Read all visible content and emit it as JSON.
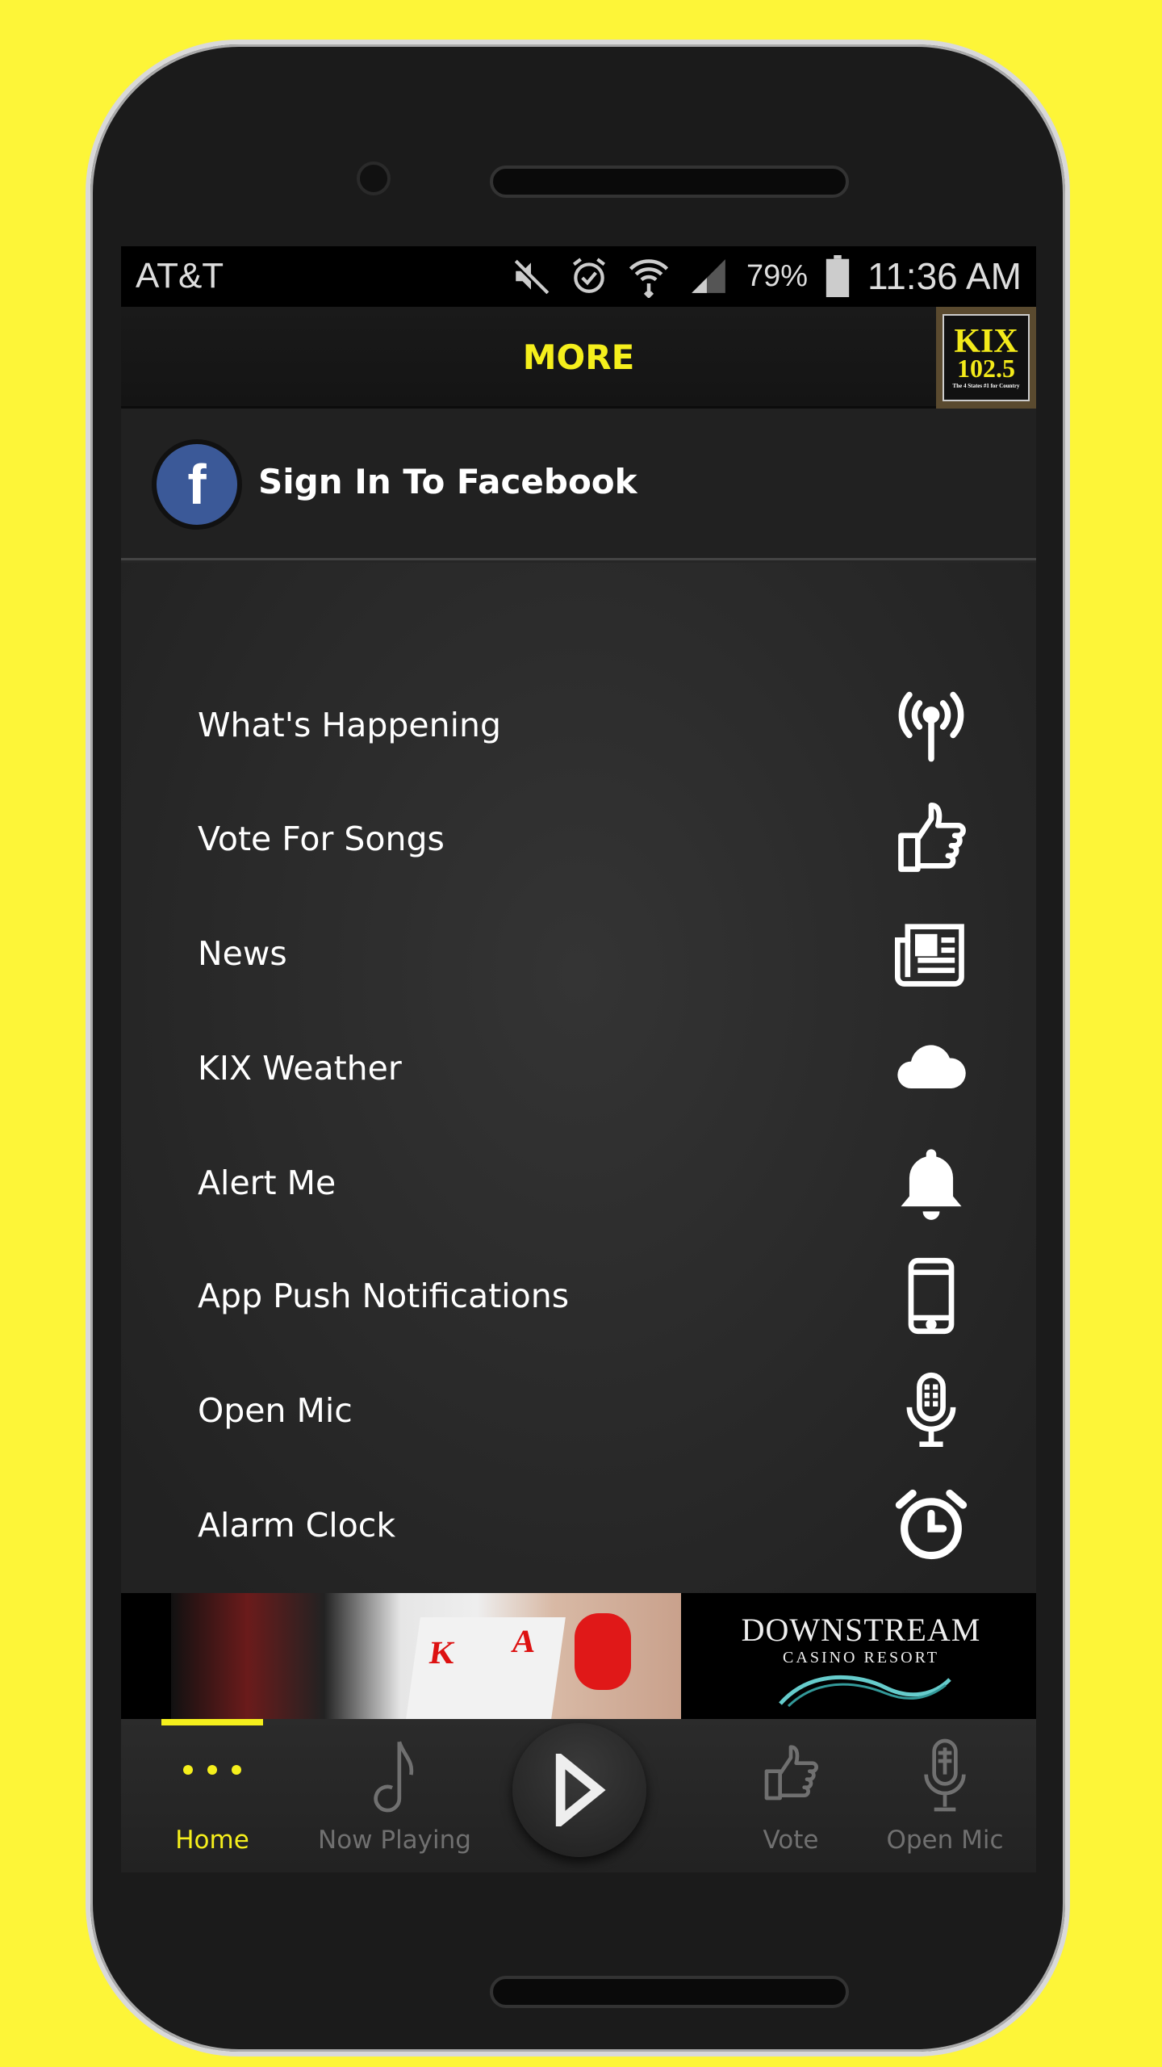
{
  "status_bar": {
    "carrier": "AT&T",
    "battery": "79%",
    "time": "11:36 AM",
    "icons": [
      "mute-icon",
      "alarm-icon",
      "wifi-icon",
      "signal-icon",
      "battery-icon"
    ]
  },
  "header": {
    "title": "MORE",
    "logo": {
      "line1": "KIX",
      "line2": "102.5",
      "tagline": "The 4 States #1 for Country"
    }
  },
  "facebook": {
    "label": "Sign In To Facebook"
  },
  "menu": {
    "items": [
      {
        "label": "What's Happening",
        "icon": "broadcast-icon"
      },
      {
        "label": "Vote For Songs",
        "icon": "thumbs-up-icon"
      },
      {
        "label": "News",
        "icon": "newspaper-icon"
      },
      {
        "label": "KIX Weather",
        "icon": "cloud-icon"
      },
      {
        "label": "Alert Me",
        "icon": "bell-icon"
      },
      {
        "label": "App Push Notifications",
        "icon": "phone-icon"
      },
      {
        "label": "Open Mic",
        "icon": "microphone-icon"
      },
      {
        "label": "Alarm Clock",
        "icon": "alarm-clock-icon"
      }
    ]
  },
  "ad": {
    "brand": "DOWNSTREAM",
    "sub": "CASINO RESORT",
    "card_k": "K",
    "card_a": "A"
  },
  "nav": {
    "items": [
      {
        "label": "Home",
        "icon": "more-dots-icon",
        "active": true
      },
      {
        "label": "Now Playing",
        "icon": "music-note-icon"
      },
      {
        "label": "Vote",
        "icon": "thumbs-up-icon"
      },
      {
        "label": "Open Mic",
        "icon": "microphone-icon"
      }
    ],
    "play_icon": "play-icon"
  },
  "colors": {
    "accent": "#f5ef1c",
    "background": "#fdf538",
    "facebook": "#3b5998"
  }
}
